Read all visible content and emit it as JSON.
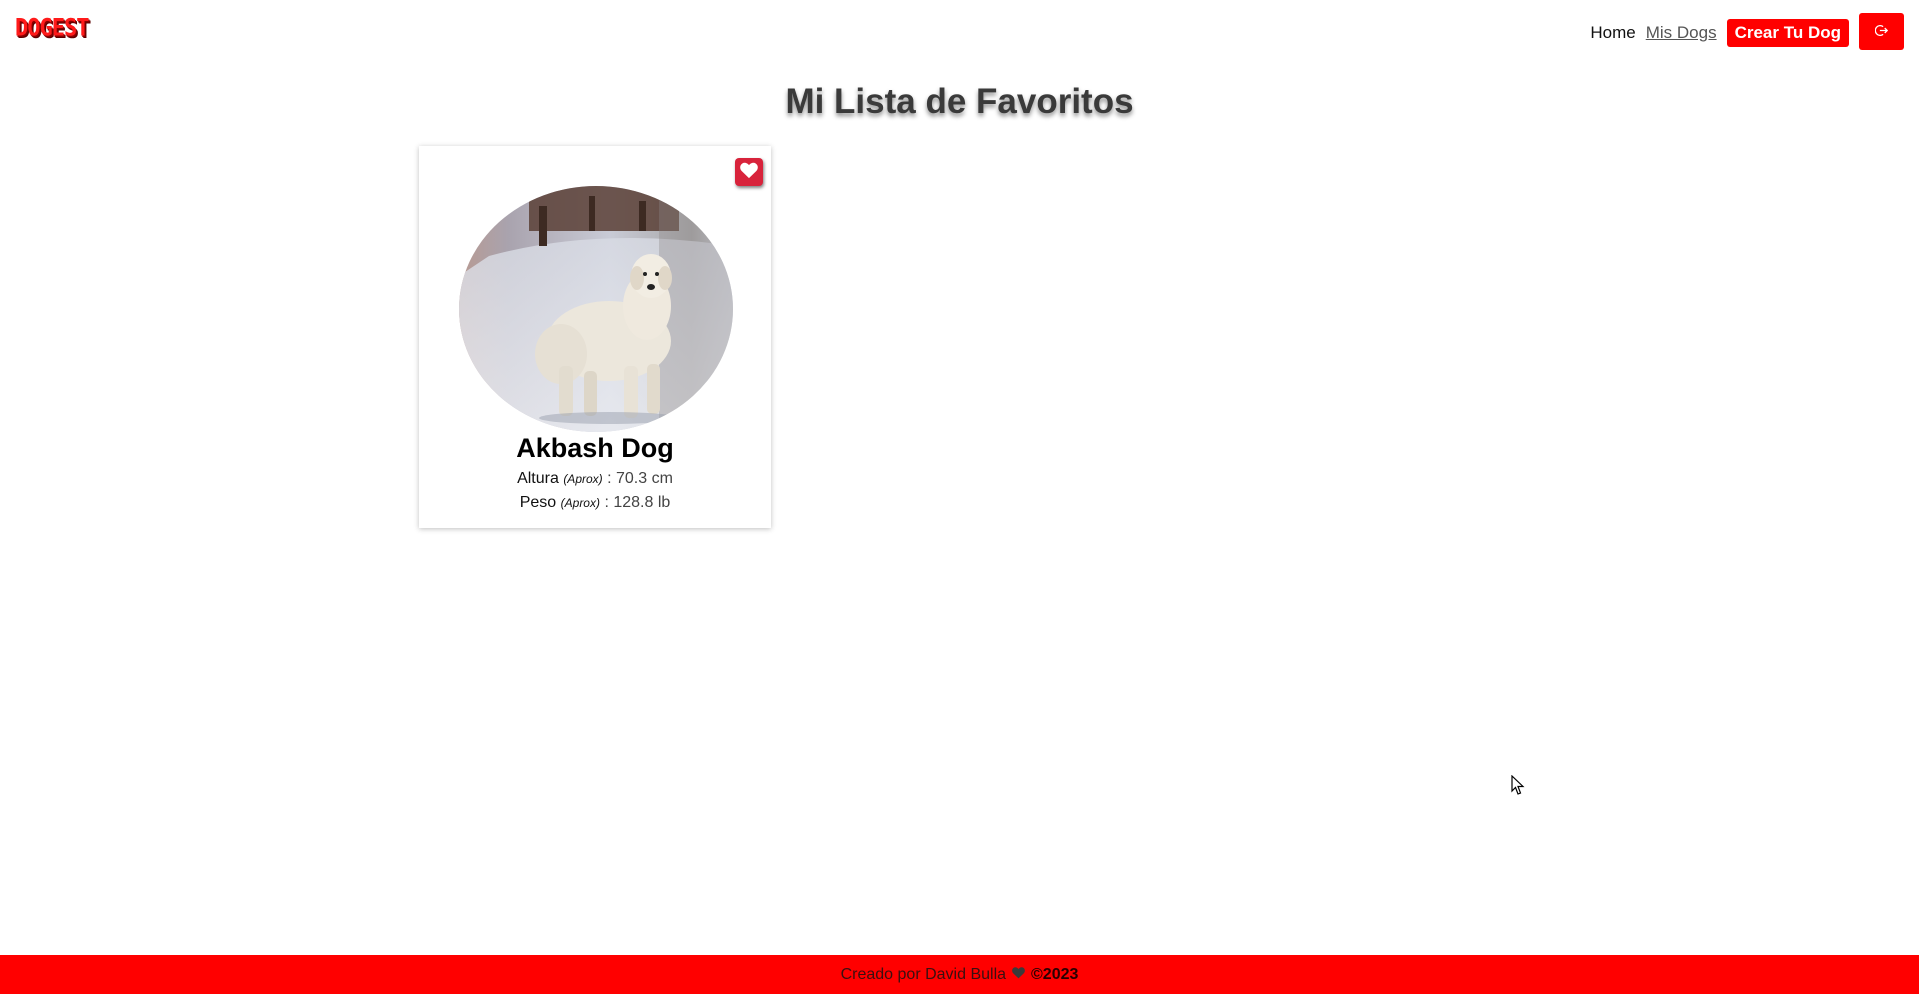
{
  "header": {
    "logo": "DOGEST",
    "nav": {
      "home": "Home",
      "mis_dogs": "Mis Dogs",
      "crear": "Crear Tu Dog"
    },
    "logout_icon": "logout-icon"
  },
  "main": {
    "title": "Mi Lista de Favoritos",
    "cards": [
      {
        "name": "Akbash Dog",
        "favorite": true,
        "favorite_icon": "heart-icon",
        "altura_label": "Altura",
        "altura_aprox": "(Aprox)",
        "altura_value": ": 70.3 cm",
        "peso_label": "Peso",
        "peso_aprox": "(Aprox)",
        "peso_value": ": 128.8 lb"
      }
    ]
  },
  "footer": {
    "text": "Creado por David Bulla",
    "heart_icon": "heart-icon",
    "copyright": "©2023"
  },
  "colors": {
    "accent": "#ff0000",
    "favorite": "#d8233b"
  }
}
